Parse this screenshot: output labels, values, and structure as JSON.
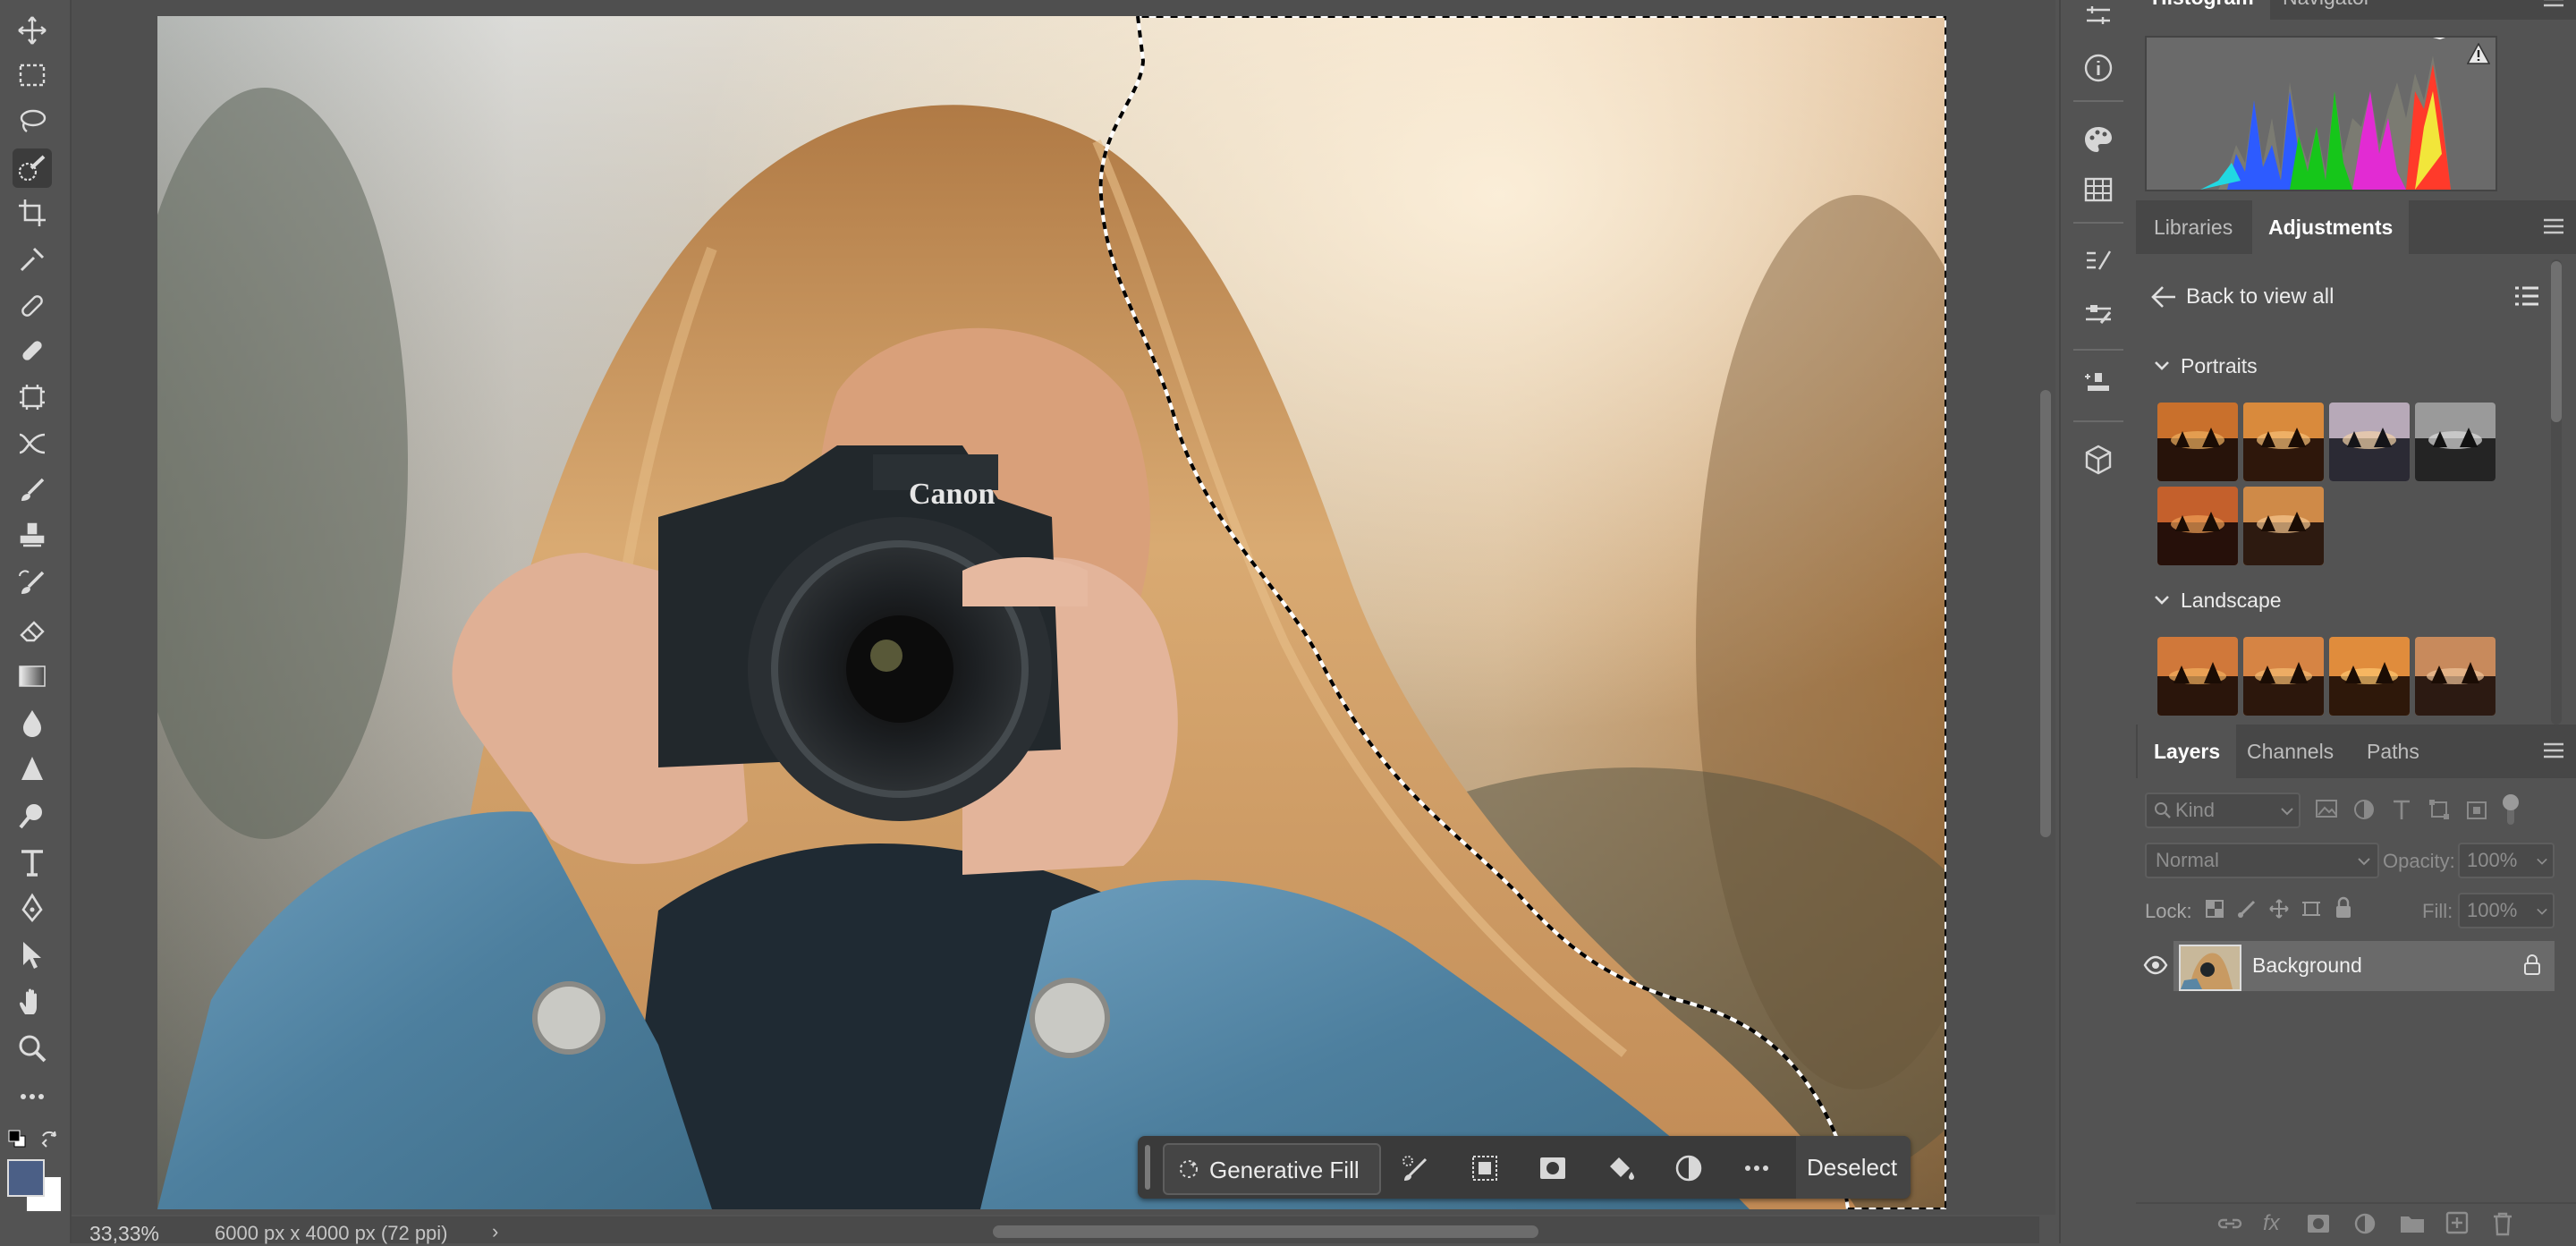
{
  "status": {
    "zoom": "33,33%",
    "doc_info": "6000 px x 4000 px (72 ppi)"
  },
  "taskbar": {
    "generative_fill": "Generative Fill",
    "deselect": "Deselect"
  },
  "panels": {
    "top_tabs": [
      "Histogram",
      "Navigator"
    ],
    "mid_tabs": [
      "Libraries",
      "Adjustments"
    ],
    "back_label": "Back to view all",
    "sections": {
      "portraits": "Portraits",
      "landscape": "Landscape"
    },
    "layers_tabs": [
      "Layers",
      "Channels",
      "Paths"
    ],
    "filter_kind": "Kind",
    "blend_mode": "Normal",
    "opacity_label": "Opacity:",
    "opacity_value": "100%",
    "lock_label": "Lock:",
    "fill_label": "Fill:",
    "fill_value": "100%",
    "layer_name": "Background"
  },
  "colors": {
    "foreground": "#4b5f86",
    "background": "#ffffff",
    "accent": "#2d8ceb"
  }
}
